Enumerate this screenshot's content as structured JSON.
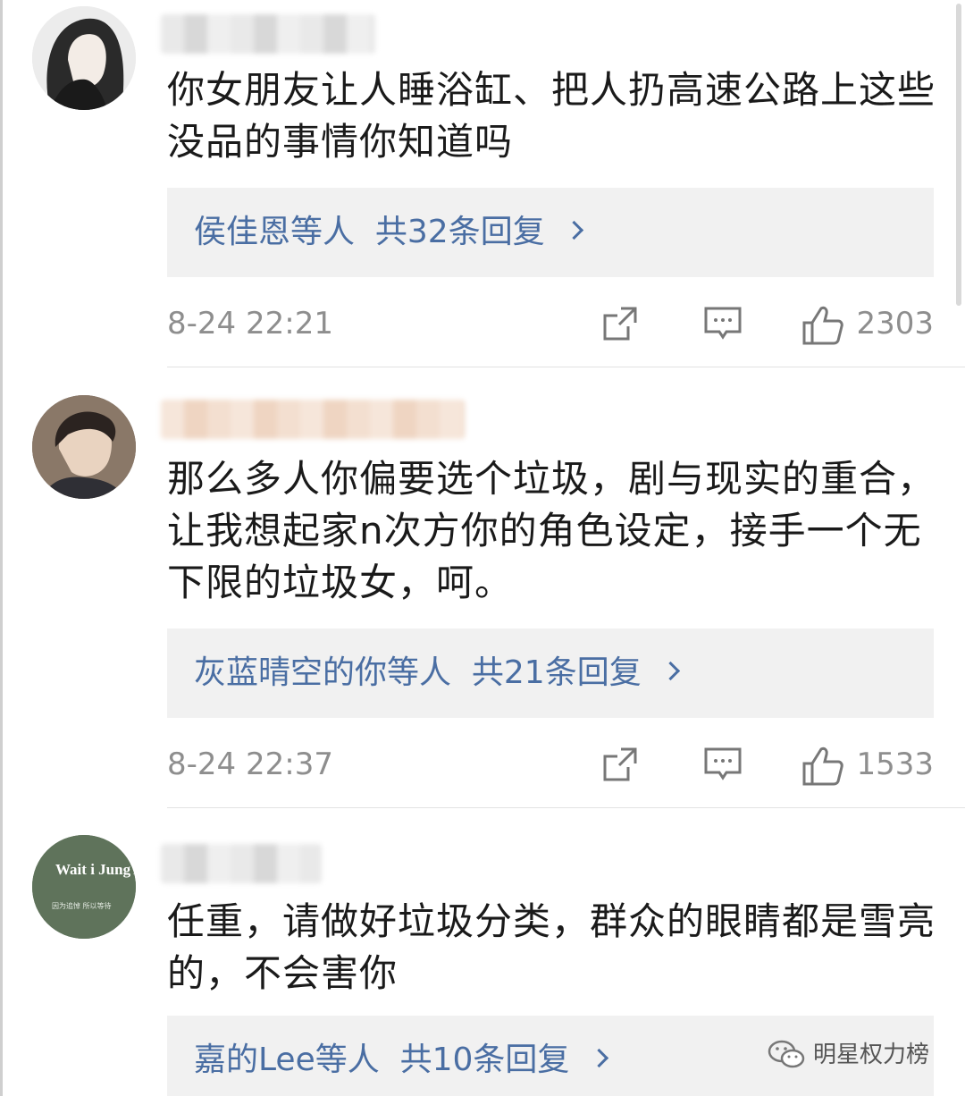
{
  "comments": [
    {
      "text": "你女朋友让人睡浴缸、把人扔高速公路上这些没品的事情你知道吗",
      "reply_names": "侯佳恩等人",
      "reply_count": "共32条回复",
      "time": "8-24 22:21",
      "likes": "2303"
    },
    {
      "text": "那么多人你偏要选个垃圾，剧与现实的重合，让我想起家n次方你的角色设定，接手一个无下限的垃圾女，呵。",
      "reply_names": "灰蓝晴空的你等人",
      "reply_count": "共21条回复",
      "time": "8-24 22:37",
      "likes": "1533"
    },
    {
      "text": "任重，请做好垃圾分类，群众的眼睛都是雪亮的，不会害你",
      "reply_names": "嘉的Lee等人",
      "reply_count": "共10条回复",
      "avatar_text": "Wait i JungYong",
      "avatar_subtext": "因为追悼 所以等待"
    }
  ],
  "watermark": "明星权力榜",
  "colors": {
    "link": "#4a6ea3",
    "reply_bg": "#f1f1f1",
    "meta": "#8e8e8e"
  }
}
